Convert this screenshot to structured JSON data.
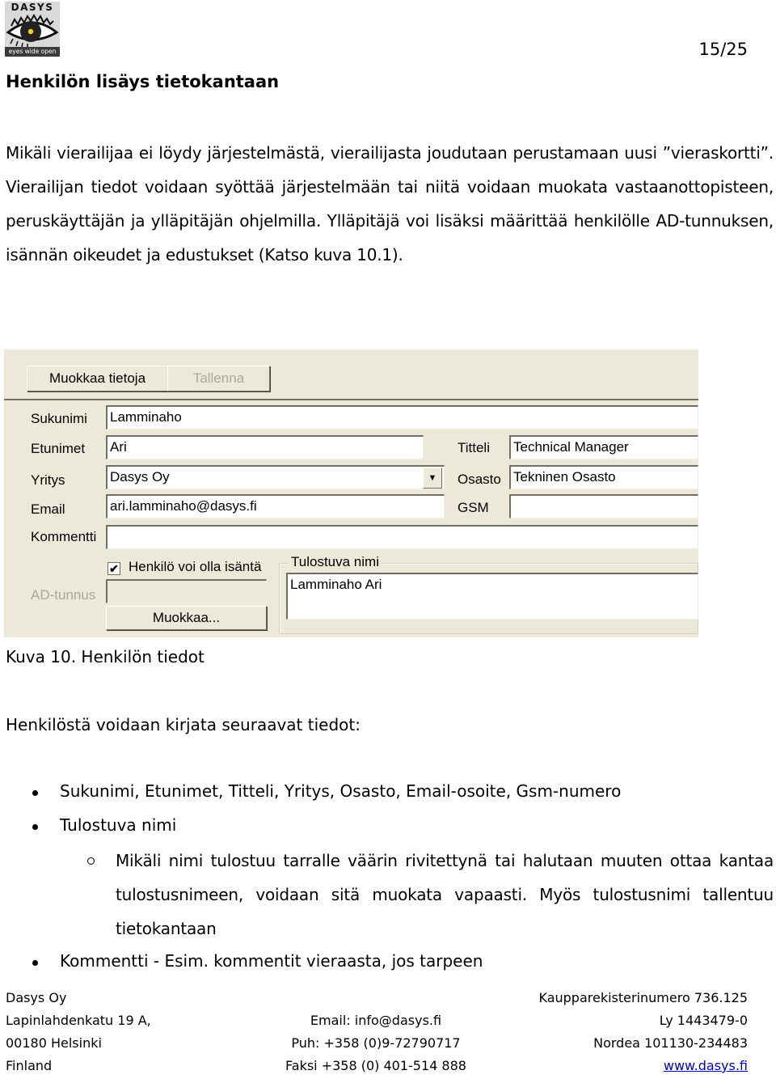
{
  "header": {
    "logo": {
      "brand": "DASYS",
      "tagline": "eyes wide open",
      "icon": "eye-icon"
    },
    "page_number": "15/25",
    "title": "Henkilön lisäys tietokantaan"
  },
  "intro_paragraph": "Mikäli vierailijaa ei löydy järjestelmästä, vierailijasta joudutaan perustamaan uusi ”vieraskortti”. Vierailijan tiedot voidaan syöttää järjestelmään tai niitä voidaan muokata vastaanottopisteen, peruskäyttäjän ja ylläpitäjän ohjelmilla. Ylläpitäjä voi lisäksi määrittää henkilölle AD-tunnuksen, isännän oikeudet ja edustukset (Katso kuva 10.1).",
  "form": {
    "buttons": {
      "edit": "Muokkaa tietoja",
      "save": "Tallenna",
      "ad_edit": "Muokkaa..."
    },
    "fields": {
      "sukunimi": {
        "label": "Sukunimi",
        "value": "Lamminaho"
      },
      "etunimet": {
        "label": "Etunimet",
        "value": "Ari"
      },
      "yritys": {
        "label": "Yritys",
        "value": "Dasys Oy"
      },
      "email": {
        "label": "Email",
        "value": "ari.lamminaho@dasys.fi"
      },
      "kommentti": {
        "label": "Kommentti",
        "value": ""
      },
      "titteli": {
        "label": "Titteli",
        "value": "Technical Manager"
      },
      "osasto": {
        "label": "Osasto",
        "value": "Tekninen Osasto"
      },
      "gsm": {
        "label": "GSM",
        "value": ""
      },
      "ad_tunnus": {
        "label": "AD-tunnus",
        "value": ""
      }
    },
    "host_checkbox": {
      "label": "Henkilö voi olla isäntä",
      "checked": true,
      "mark": "✔"
    },
    "print_name": {
      "group_label": "Tulostuva nimi",
      "value": "Lamminaho Ari"
    },
    "dropdown_arrow": "▼"
  },
  "figure_caption": "Kuva 10. Henkilön tiedot",
  "list_intro": "Henkilöstä voidaan kirjata seuraavat tiedot:",
  "list": {
    "item1": "Sukunimi, Etunimet, Titteli, Yritys, Osasto, Email-osoite, Gsm-numero",
    "item2": "Tulostuva nimi",
    "item2_sub": "Mikäli nimi tulostuu tarralle väärin rivitettynä tai halutaan muuten ottaa kantaa tulostusnimeen, voidaan sitä muokata vapaasti. Myös tulostusnimi tallentuu tietokantaan",
    "item3": "Kommentti - Esim. kommentit vieraasta, jos tarpeen"
  },
  "footer": {
    "left": [
      "Dasys Oy",
      "Lapinlahdenkatu 19 A,",
      "00180 Helsinki",
      "Finland"
    ],
    "center": [
      "Email: info@dasys.fi",
      "Puh: +358 (0)9-72790717",
      "Faksi +358 (0) 401-514 888"
    ],
    "right": [
      "Kaupparekisterinumero 736.125",
      "Ly 1443479-0",
      "Nordea 101130-234483"
    ],
    "website": "www.dasys.fi"
  }
}
